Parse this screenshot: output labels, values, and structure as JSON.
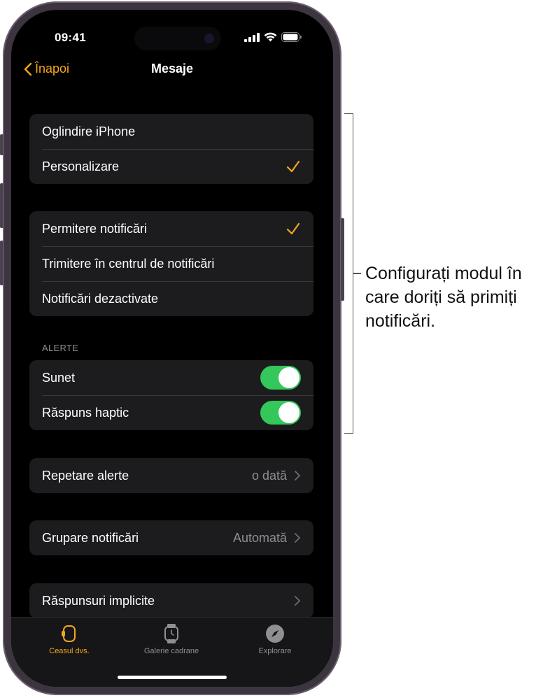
{
  "status": {
    "time": "09:41"
  },
  "nav": {
    "back_label": "Înapoi",
    "title": "Mesaje"
  },
  "group1": {
    "items": [
      {
        "label": "Oglindire iPhone"
      },
      {
        "label": "Personalizare",
        "checked": true
      }
    ]
  },
  "group2": {
    "items": [
      {
        "label": "Permitere notificări",
        "checked": true
      },
      {
        "label": "Trimitere în centrul de notificări"
      },
      {
        "label": "Notificări dezactivate"
      }
    ]
  },
  "alerts": {
    "header": "ALERTE",
    "items": [
      {
        "label": "Sunet",
        "on": true
      },
      {
        "label": "Răspuns haptic",
        "on": true
      }
    ]
  },
  "repeat": {
    "label": "Repetare alerte",
    "value": "o dată"
  },
  "grouping": {
    "label": "Grupare notificări",
    "value": "Automată"
  },
  "replies": {
    "label": "Răspunsuri implicite"
  },
  "tabs": [
    {
      "label": "Ceasul dvs.",
      "icon": "watch-icon",
      "active": true
    },
    {
      "label": "Galerie cadrane",
      "icon": "watch-face-icon"
    },
    {
      "label": "Explorare",
      "icon": "compass-icon"
    }
  ],
  "callout": {
    "text": "Configurați modul în care doriți să primiți notificări."
  },
  "colors": {
    "accent": "#f3a61e",
    "toggle_on": "#34c759",
    "background": "#000000",
    "cell": "#1c1c1e"
  }
}
